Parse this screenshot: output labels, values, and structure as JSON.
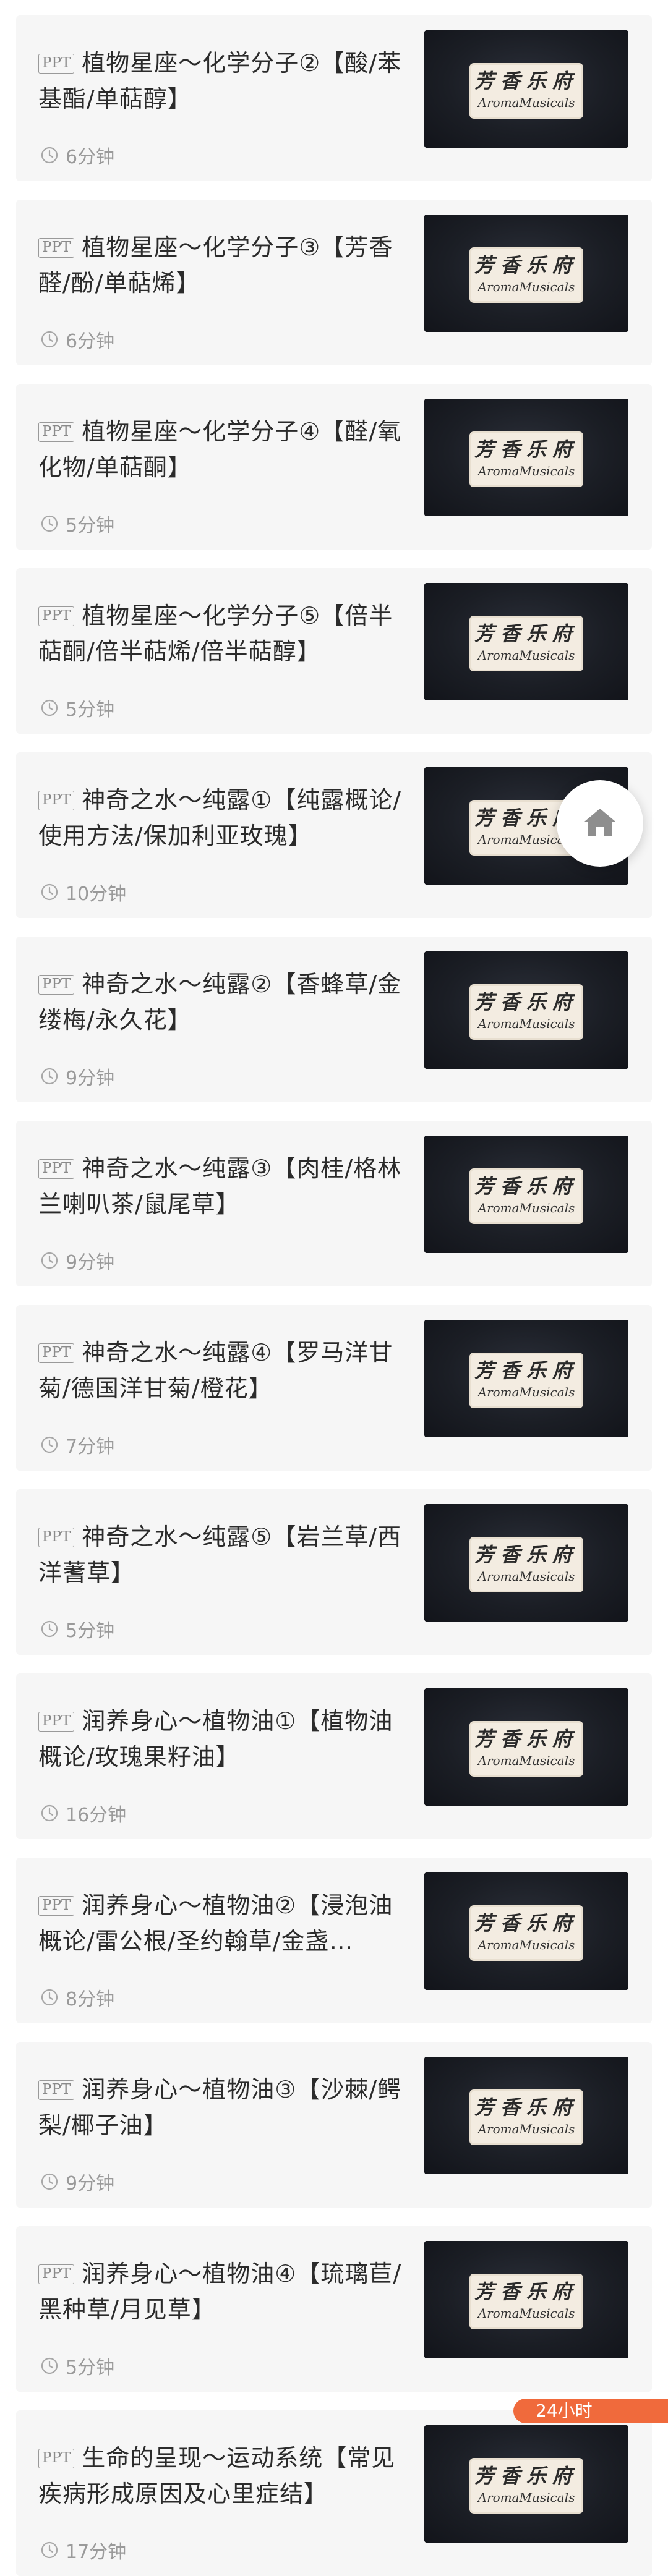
{
  "tag_label": "PPT",
  "courses": [
    {
      "title": "植物星座～化学分子②【酸/苯基酯/单萜醇】",
      "duration": "6分钟"
    },
    {
      "title": "植物星座～化学分子③【芳香醛/酚/单萜烯】",
      "duration": "6分钟"
    },
    {
      "title": "植物星座～化学分子④【醛/氧化物/单萜酮】",
      "duration": "5分钟"
    },
    {
      "title": "植物星座～化学分子⑤【倍半萜酮/倍半萜烯/倍半萜醇】",
      "duration": "5分钟"
    },
    {
      "title": "神奇之水～纯露①【纯露概论/使用方法/保加利亚玫瑰】",
      "duration": "10分钟"
    },
    {
      "title": "神奇之水～纯露②【香蜂草/金缕梅/永久花】",
      "duration": "9分钟"
    },
    {
      "title": "神奇之水～纯露③【肉桂/格林兰喇叭茶/鼠尾草】",
      "duration": "9分钟"
    },
    {
      "title": "神奇之水～纯露④【罗马洋甘菊/德国洋甘菊/橙花】",
      "duration": "7分钟"
    },
    {
      "title": "神奇之水～纯露⑤【岩兰草/西洋蓍草】",
      "duration": "5分钟"
    },
    {
      "title": "润养身心～植物油①【植物油概论/玫瑰果籽油】",
      "duration": "16分钟"
    },
    {
      "title": "润养身心～植物油②【浸泡油概论/雷公根/圣约翰草/金盏…",
      "duration": "8分钟"
    },
    {
      "title": "润养身心～植物油③【沙棘/鳄梨/椰子油】",
      "duration": "9分钟"
    },
    {
      "title": "润养身心～植物油④【琉璃苣/黑种草/月见草】",
      "duration": "5分钟"
    },
    {
      "title": "生命的呈现～运动系统【常见疾病形成原因及心里症结】",
      "duration": "17分钟"
    }
  ],
  "thumbnail": {
    "logo_cn": "芳香乐府",
    "logo_en": "AromaMusicals"
  },
  "floating": {
    "home_icon": "home-icon",
    "promo_text": "24小时"
  },
  "colors": {
    "card_bg": "#f6f6f6",
    "title": "#2b2b2b",
    "meta": "#9a9a9a",
    "thumb_bg": "#1b1e25",
    "promo": "#f06a3c"
  }
}
